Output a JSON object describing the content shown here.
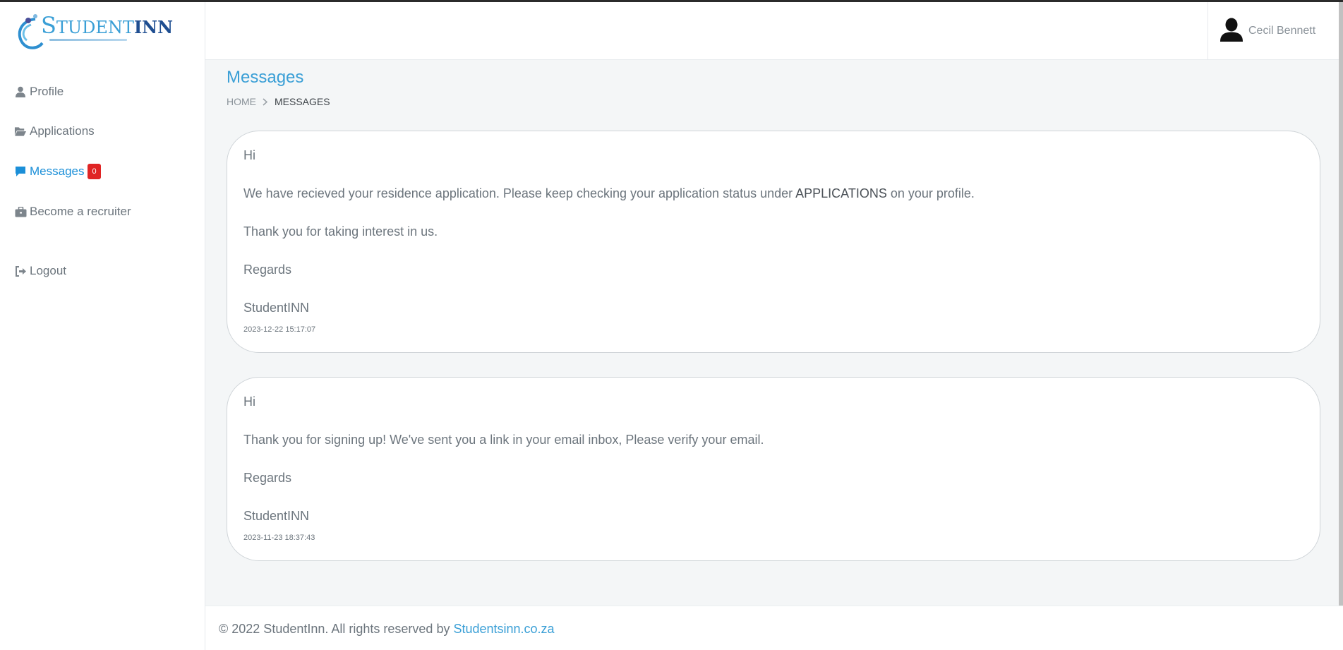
{
  "brand": {
    "logo_text_s": "S",
    "logo_text_tudent": "TUDENT",
    "logo_text_inn": "INN"
  },
  "sidebar": {
    "items": [
      {
        "label": "Profile",
        "icon": "user-icon"
      },
      {
        "label": "Applications",
        "icon": "folder-open-icon"
      },
      {
        "label": "Messages",
        "icon": "comment-icon",
        "badge": "0",
        "active": true
      },
      {
        "label": "Become a recruiter",
        "icon": "briefcase-icon"
      },
      {
        "label": "Logout",
        "icon": "sign-out-icon"
      }
    ]
  },
  "header": {
    "user_name": "Cecil Bennett"
  },
  "page": {
    "title": "Messages",
    "breadcrumb": {
      "home": "HOME",
      "current": "MESSAGES"
    }
  },
  "messages": [
    {
      "greeting": "Hi",
      "body_before": "We have recieved your residence application. Please keep checking your application status under ",
      "body_emphasis": "APPLICATIONS",
      "body_after": " on your profile.",
      "thanks": "Thank you for taking interest in us.",
      "regards": "Regards",
      "signature": "StudentINN",
      "date": "2023-12-22 15:17:07"
    },
    {
      "greeting": "Hi",
      "body": "Thank you for signing up! We've sent you a link in your email inbox, Please verify your email.",
      "regards": "Regards",
      "signature": "StudentINN",
      "date": "2023-11-23 18:37:43"
    }
  ],
  "footer": {
    "text": "© 2022 StudentInn. All rights reserved by ",
    "link": "Studentsinn.co.za"
  },
  "colors": {
    "accent": "#3a9fd6",
    "active_nav": "#1b8fd8",
    "badge": "#e02424",
    "background": "#f4f6f7"
  }
}
